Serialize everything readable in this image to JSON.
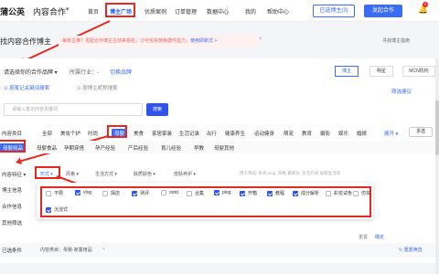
{
  "header": {
    "logo": "蒲公英",
    "logo_sub": "内容合作",
    "nav": [
      "首页",
      "博主广场",
      "优质案例",
      "订单管理",
      "数据中心",
      "我的",
      "帮助中心"
    ],
    "buttons": {
      "register": "已选博主(3)",
      "publish": "发起合作"
    },
    "bell_badge": "9"
  },
  "page": {
    "title": "找内容合作博主",
    "notice": "每条主推？发起合作博主主动来报名，订可包先使用邀件能力，",
    "notice_link": "使用即新式 >",
    "help": "寻找博主指南"
  },
  "brand": {
    "select_label": "请选择你的合作品牌",
    "industry_label": "所属行业：-",
    "switch_label": "切换品牌",
    "segments": [
      "博主",
      "明星",
      "MCN机构"
    ]
  },
  "tabs": [
    "按笔记关键词搜索",
    "按博主昵称搜索"
  ],
  "filter_link": "筛选建议",
  "search": {
    "placeholder": "请输入笔记内容关键词",
    "button": "搜索"
  },
  "categories": {
    "label": "内容类目",
    "items": [
      "全部",
      "美妆个护",
      "时尚",
      "母婴",
      "美食",
      "家居家装",
      "生活记录",
      "出行",
      "健康养生",
      "运动健身",
      "萌宠",
      "教育",
      "摄影",
      "娱乐",
      "婚嫁"
    ],
    "expand": "展开",
    "multi": "多选"
  },
  "sub_categories": [
    "母婴用品",
    "母婴食品",
    "孕期穿搭",
    "孕产经验",
    "产后经验",
    "育儿经验",
    "早教",
    "母婴其他"
  ],
  "features": {
    "label": "内容特征",
    "dropdowns": [
      "形式",
      "风格",
      "生活方式",
      "肤质肤色",
      "皮肤养护"
    ],
    "hint": "用于筛选: 形式-vlog, 风格-素颜派, 生活方式-居家生活等"
  },
  "popup": {
    "options": [
      {
        "label": "不限",
        "checked": false
      },
      {
        "label": "vlog",
        "checked": true
      },
      {
        "label": "探店",
        "checked": false
      },
      {
        "label": "测评",
        "checked": true
      },
      {
        "label": "ootd",
        "checked": false
      },
      {
        "label": "合集",
        "checked": false
      },
      {
        "label": "plog",
        "checked": true
      },
      {
        "label": "开箱",
        "checked": true
      },
      {
        "label": "教程",
        "checked": true
      },
      {
        "label": "成分解析",
        "checked": true
      },
      {
        "label": "彩妆试色",
        "checked": false
      },
      {
        "label": "仿妆",
        "checked": false
      },
      {
        "label": "沉浸式",
        "checked": true
      }
    ],
    "reset": "重置",
    "confirm": "确定"
  },
  "side_labels": [
    "博主信息",
    "合作信息",
    "其他筛选"
  ],
  "selected": {
    "label": "已选条件",
    "tag": "内容类目：母婴-家童用品",
    "reset": "重置筛选"
  },
  "colors": {
    "accent": "#3b6cf5",
    "annotation": "#e8281e"
  }
}
